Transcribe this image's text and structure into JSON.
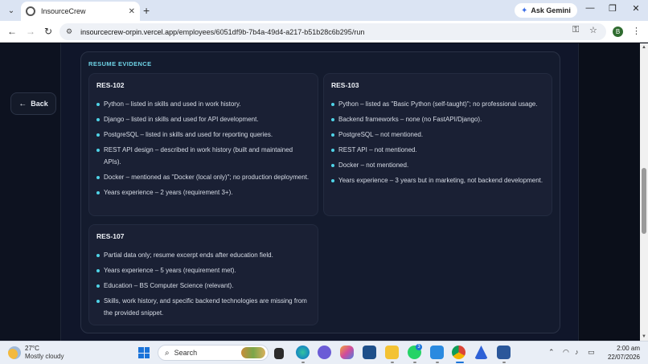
{
  "browser": {
    "tab_title": "InsourceCrew",
    "tab_close": "✕",
    "new_tab": "+",
    "gemini_label": "Ask Gemini",
    "url_host": "insourcecrew-orpin.vercel.app",
    "url_path": "/employees/6051df9b-7b4a-49d4-a217-b51b28c6b295/run",
    "profile_initial": "B",
    "minimize": "—",
    "maximize": "❐",
    "close": "✕"
  },
  "page": {
    "back_label": "Back",
    "section_title": "RESUME EVIDENCE",
    "cards": [
      {
        "id": "RES-102",
        "items": [
          "Python – listed in skills and used in work history.",
          "Django – listed in skills and used for API development.",
          "PostgreSQL – listed in skills and used for reporting queries.",
          "REST API design – described in work history (built and maintained APIs).",
          "Docker – mentioned as \"Docker (local only)\"; no production deployment.",
          "Years experience – 2 years (requirement 3+)."
        ]
      },
      {
        "id": "RES-103",
        "items": [
          "Python – listed as \"Basic Python (self-taught)\"; no professional usage.",
          "Backend frameworks – none (no FastAPI/Django).",
          "PostgreSQL – not mentioned.",
          "REST API – not mentioned.",
          "Docker – not mentioned.",
          "Years experience – 3 years but in marketing, not backend development."
        ]
      },
      {
        "id": "RES-107",
        "items": [
          "Partial data only; resume excerpt ends after education field.",
          "Years experience – 5 years (requirement met).",
          "Education – BS Computer Science (relevant).",
          "Skills, work history, and specific backend technologies are missing from the provided snippet."
        ]
      }
    ]
  },
  "taskbar": {
    "temperature": "27°C",
    "weather": "Mostly cloudy",
    "search_placeholder": "Search",
    "whatsapp_badge": "3",
    "time": "2:00 am",
    "date": "22/07/2026"
  }
}
